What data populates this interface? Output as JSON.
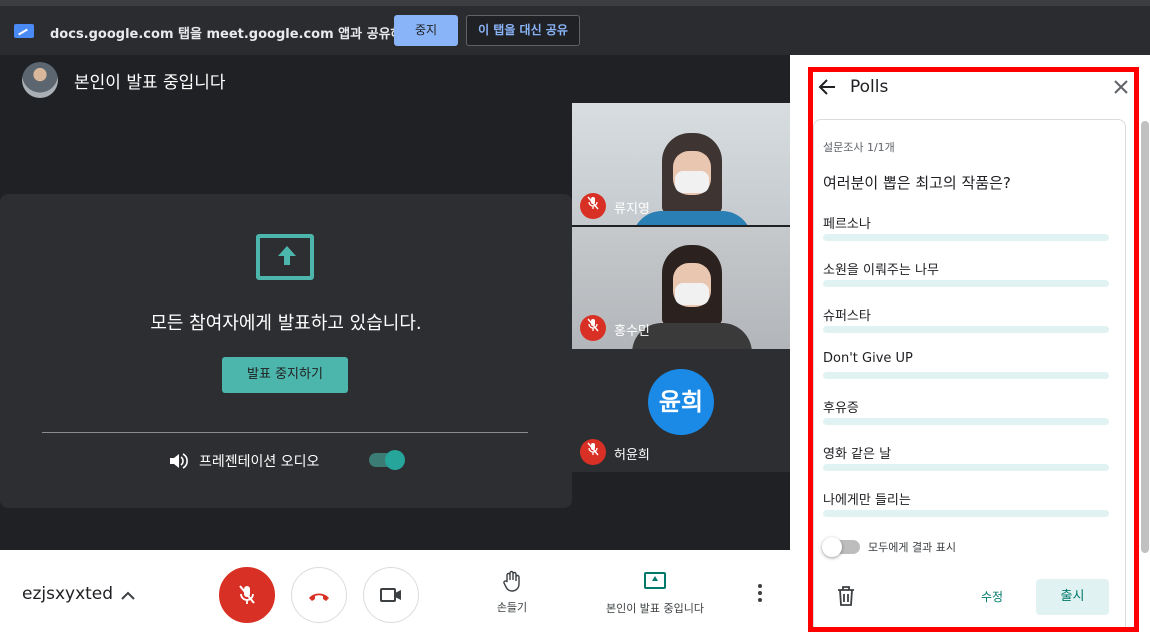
{
  "share_bar": {
    "text": "docs.google.com 탭을 meet.google.com 앱과 공유하는 중",
    "stop_label": "중지",
    "share_this_tab_label": "이 탭을 대신 공유"
  },
  "stage": {
    "presenter_label": "본인이 발표 중입니다",
    "present_message": "모든 참여자에게 발표하고 있습니다.",
    "stop_presenting_label": "발표 중지하기",
    "audio_label": "프레젠테이션 오디오",
    "audio_on": true
  },
  "participants": [
    {
      "name": "류지영",
      "muted": true
    },
    {
      "name": "홍수민",
      "muted": true
    },
    {
      "name": "허윤희",
      "muted": true,
      "avatar_text": "윤희",
      "avatar_color": "#1a8ae6"
    }
  ],
  "bottom_bar": {
    "meeting_code": "ezjsxyxted",
    "raise_hand_label": "손들기",
    "now_presenting_label": "본인이 발표 중입니다"
  },
  "polls": {
    "title": "Polls",
    "count_label": "설문조사 1/1개",
    "question": "여러분이 뽑은 최고의 작품은?",
    "options": [
      "페르소나",
      "소원을 이뤄주는 나무",
      "슈퍼스타",
      "Don't Give UP",
      "후유증",
      "영화 같은 날",
      "나에게만 들리는"
    ],
    "show_results_label": "모두에게 결과 표시",
    "show_results_on": false,
    "edit_label": "수정",
    "launch_label": "출시"
  },
  "colors": {
    "accent": "#4db6ac",
    "danger": "#d93025",
    "blue": "#8ab4f8",
    "highlight": "#ff0000"
  }
}
